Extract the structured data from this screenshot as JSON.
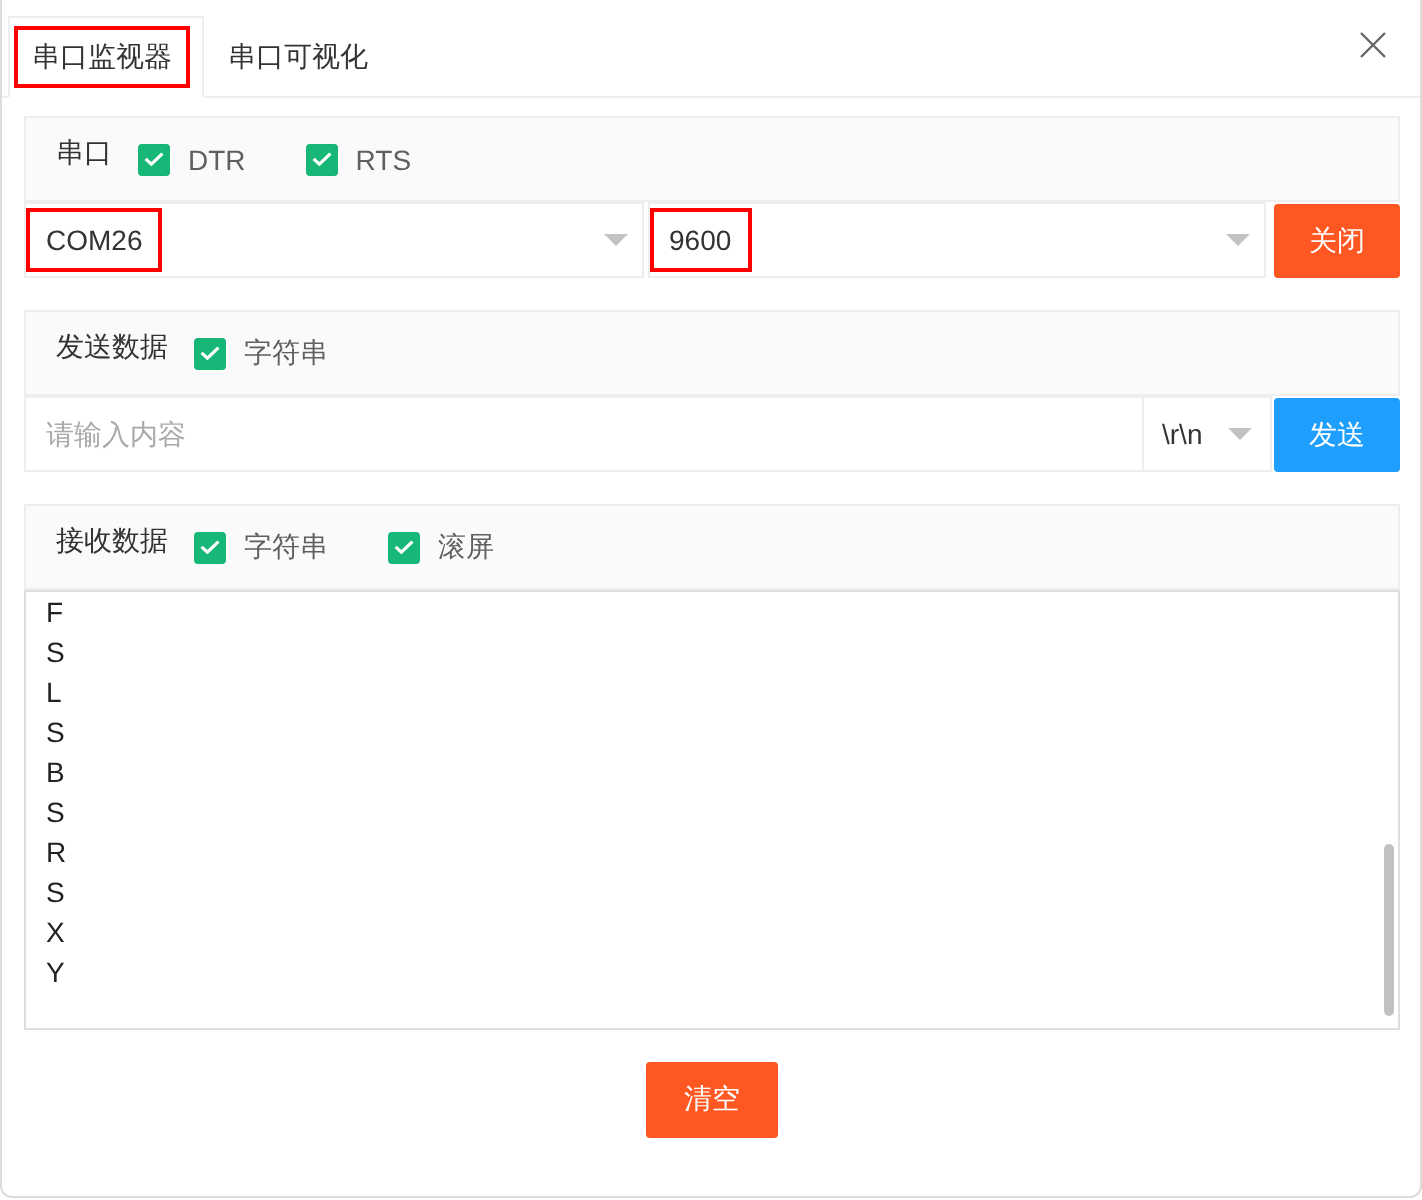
{
  "tabs": [
    {
      "label": "串口监视器",
      "selected": true,
      "highlighted": true
    },
    {
      "label": "串口可视化",
      "selected": false,
      "highlighted": false
    }
  ],
  "serial_port": {
    "title": "串口",
    "options": [
      {
        "label": "DTR",
        "checked": true
      },
      {
        "label": "RTS",
        "checked": true
      }
    ],
    "port": {
      "value": "COM26",
      "highlighted": true
    },
    "baud_rate": {
      "value": "9600",
      "highlighted": true
    },
    "button": "关闭"
  },
  "send": {
    "title": "发送数据",
    "options": [
      {
        "label": "字符串",
        "checked": true
      }
    ],
    "input": {
      "placeholder": "请输入内容"
    },
    "line_ending": "\\r\\n",
    "button": "发送"
  },
  "receive": {
    "title": "接收数据",
    "options": [
      {
        "label": "字符串",
        "checked": true
      },
      {
        "label": "滚屏",
        "checked": true
      }
    ],
    "lines": [
      "F",
      "S",
      "L",
      "S",
      "B",
      "S",
      "R",
      "S",
      "X",
      "Y"
    ]
  },
  "clear_button": "清空"
}
